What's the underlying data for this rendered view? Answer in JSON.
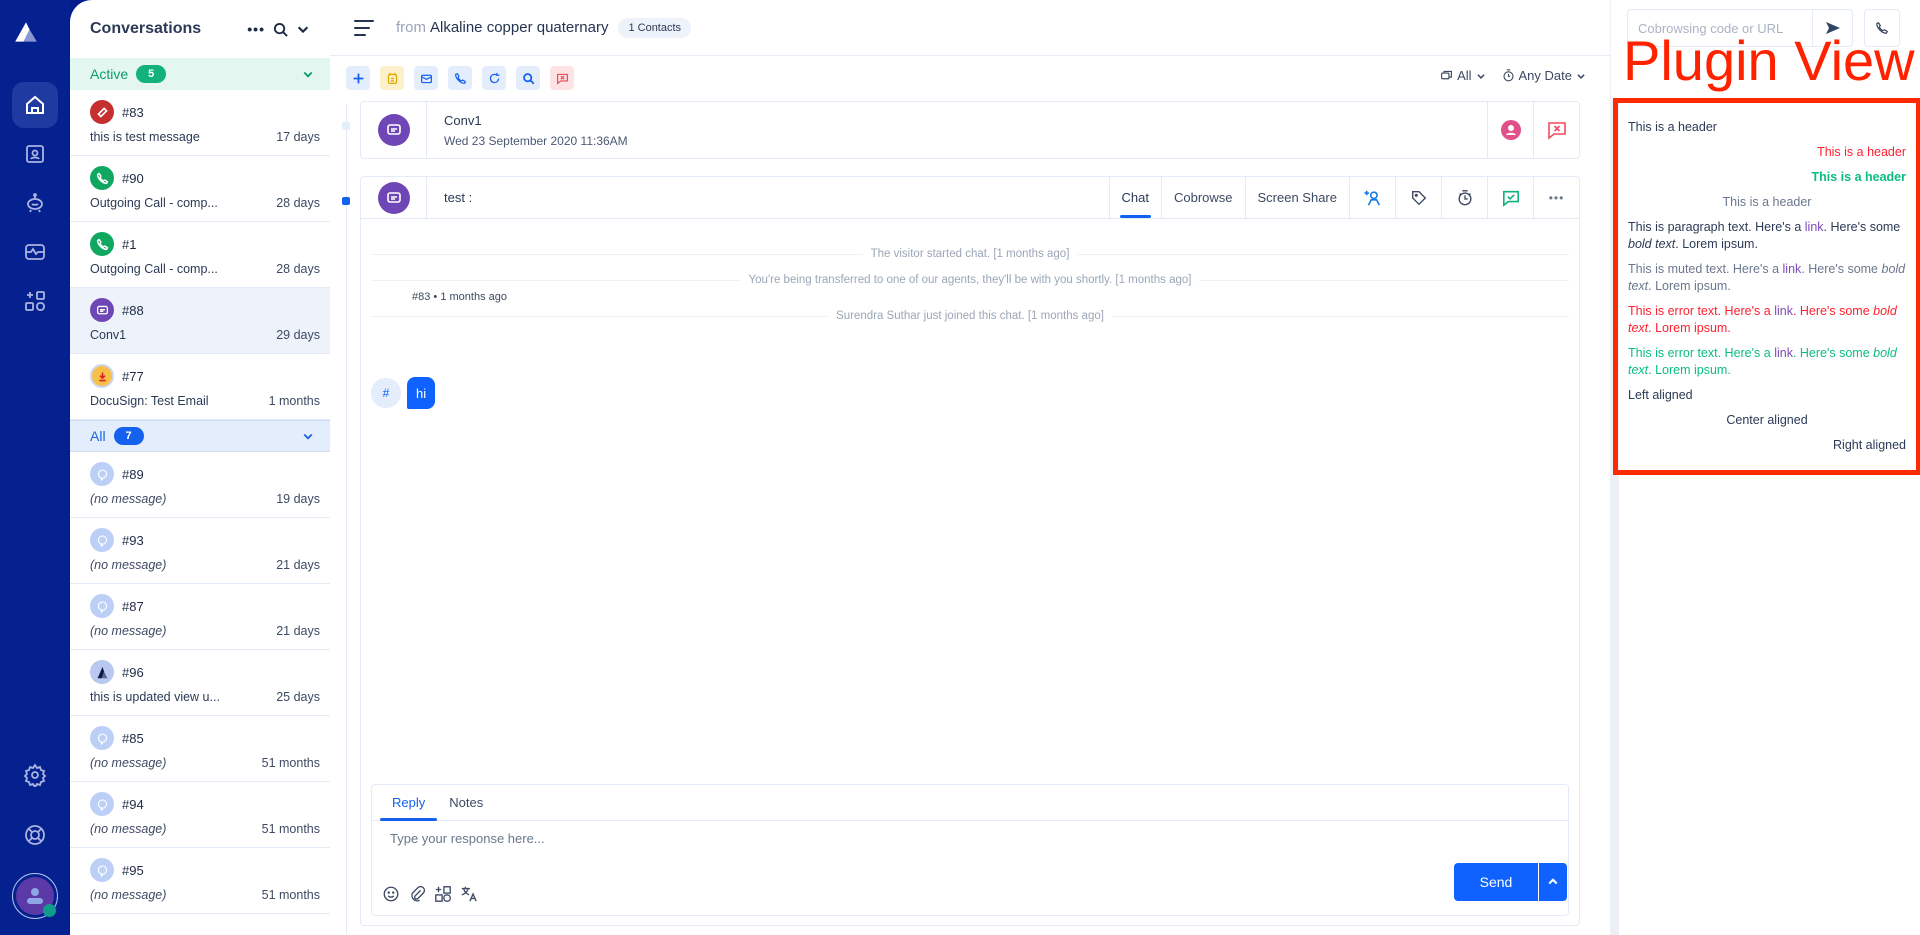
{
  "rail": {
    "items": [
      {
        "name": "home",
        "active": true
      },
      {
        "name": "contacts"
      },
      {
        "name": "bots"
      },
      {
        "name": "analytics"
      },
      {
        "name": "apps"
      }
    ],
    "bottom": [
      "settings",
      "help"
    ]
  },
  "conversations": {
    "title": "Conversations",
    "sections": {
      "active": {
        "label": "Active",
        "count": "5"
      },
      "all": {
        "label": "All",
        "count": "7"
      }
    },
    "active_items": [
      {
        "id": "#83",
        "message": "this is test message",
        "time": "17 days",
        "icon": "ticket-icon",
        "color": "#c62f2f"
      },
      {
        "id": "#90",
        "message": "Outgoing Call - comp...",
        "time": "28 days",
        "icon": "phone-icon",
        "color": "#10a860"
      },
      {
        "id": "#1",
        "message": "Outgoing Call - comp...",
        "time": "28 days",
        "icon": "phone-icon",
        "color": "#10a860"
      },
      {
        "id": "#88",
        "message": "Conv1",
        "time": "29 days",
        "icon": "chat-icon",
        "color": "#6e46b6",
        "selected": true
      },
      {
        "id": "#77",
        "message": "DocuSign: Test Email",
        "time": "1 months",
        "icon": "download-icon",
        "color": "#f6c04a"
      }
    ],
    "all_items": [
      {
        "id": "#89",
        "message": "(no message)",
        "time": "19 days"
      },
      {
        "id": "#93",
        "message": "(no message)",
        "time": "21 days"
      },
      {
        "id": "#87",
        "message": "(no message)",
        "time": "21 days"
      },
      {
        "id": "#96",
        "message": "this is updated view u...",
        "time": "25 days"
      },
      {
        "id": "#85",
        "message": "(no message)",
        "time": "51 months"
      },
      {
        "id": "#94",
        "message": "(no message)",
        "time": "51 months"
      },
      {
        "id": "#95",
        "message": "(no message)",
        "time": "51 months"
      }
    ]
  },
  "header": {
    "from_label": "from",
    "name": "Alkaline copper quaternary",
    "contacts": "1 Contacts"
  },
  "filters": {
    "channel": "All",
    "date": "Any Date"
  },
  "cobrowse": {
    "placeholder": "Cobrowsing code or URL"
  },
  "conversation_card": {
    "title": "Conv1",
    "date": "Wed 23 September 2020 11:36AM"
  },
  "chat": {
    "subject": "test :",
    "tabs": [
      "Chat",
      "Cobrowse",
      "Screen Share"
    ],
    "active_tab": "Chat",
    "system_messages": [
      "The visitor started chat. [1 months ago]",
      "You're being transferred to one of our agents, they'll be with you shortly. [1 months ago]",
      "Surendra Suthar just joined this chat. [1 months ago]"
    ],
    "message": {
      "avatar": "#",
      "text": "hi",
      "meta": "#83  •  1 months ago"
    }
  },
  "reply": {
    "tabs": [
      "Reply",
      "Notes"
    ],
    "active_tab": "Reply",
    "placeholder": "Type your response here...",
    "send_label": "Send"
  },
  "plugin": {
    "title": "Plugin View",
    "headers": [
      "This is a header",
      "This is a header",
      "This is a header",
      "This is a header"
    ],
    "paragraph": {
      "a": "This is paragraph text. Here's a ",
      "link": "link",
      "b": ". Here's some ",
      "bold": "bold text",
      "c": ". Lorem ipsum."
    },
    "muted": {
      "a": "This is muted text. Here's a ",
      "link": "link",
      "b": ". Here's some ",
      "bold": "bold text",
      "c": ". Lorem ipsum."
    },
    "error": {
      "a": "This is error text. Here's a ",
      "link": "link",
      "b": ". Here's some ",
      "bold": "bold text",
      "c": ". Lorem ipsum."
    },
    "success": {
      "a": "This is error text. Here's a ",
      "link": "link",
      "b": ". Here's some ",
      "bold": "bold text",
      "c": ". Lorem ipsum."
    },
    "left": "Left aligned",
    "center": "Center aligned",
    "right": "Right aligned"
  },
  "colors": {
    "rail": "#05208f",
    "primary": "#0f62fe",
    "plugin_accent": "#ff2a00"
  }
}
